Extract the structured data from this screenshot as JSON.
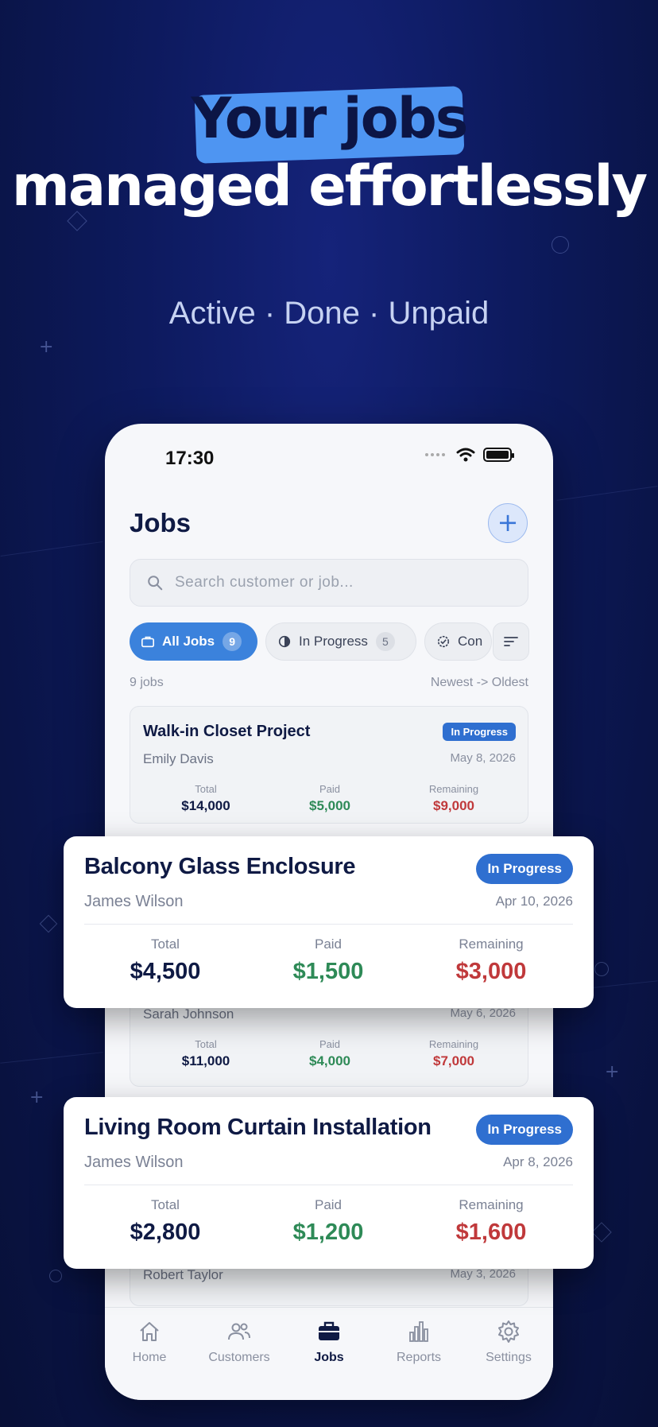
{
  "hero": {
    "highlight": "Your jobs",
    "line2": "managed effortlessly",
    "subtitle": "Active · Done · Unpaid"
  },
  "status_bar": {
    "time": "17:30"
  },
  "header": {
    "title": "Jobs",
    "add_label": "+"
  },
  "search": {
    "placeholder": "Search customer or job..."
  },
  "filters": {
    "chips": [
      {
        "label": "All Jobs",
        "count": "9"
      },
      {
        "label": "In Progress",
        "count": "5"
      },
      {
        "label": "Con"
      }
    ]
  },
  "list_meta": {
    "count": "9 jobs",
    "sort": "Newest -> Oldest"
  },
  "jobs": [
    {
      "title": "Walk-in Closet Project",
      "customer": "Emily Davis",
      "date": "May 8, 2026",
      "status": "In Progress",
      "total_label": "Total",
      "total": "$14,000",
      "paid_label": "Paid",
      "paid": "$5,000",
      "remaining_label": "Remaining",
      "remaining": "$9,000"
    },
    {
      "title": "Balcony Glass Enclosure",
      "customer": "James Wilson",
      "date": "Apr 10, 2026",
      "status": "In Progress",
      "total_label": "Total",
      "total": "$4,500",
      "paid_label": "Paid",
      "paid": "$1,500",
      "remaining_label": "Remaining",
      "remaining": "$3,000"
    },
    {
      "customer": "Sarah Johnson",
      "date": "May 6, 2026",
      "total_label": "Total",
      "total": "$11,000",
      "paid_label": "Paid",
      "paid": "$4,000",
      "remaining_label": "Remaining",
      "remaining": "$7,000"
    },
    {
      "title": "Living Room Curtain Installation",
      "customer": "James Wilson",
      "date": "Apr 8, 2026",
      "status": "In Progress",
      "total_label": "Total",
      "total": "$2,800",
      "paid_label": "Paid",
      "paid": "$1,200",
      "remaining_label": "Remaining",
      "remaining": "$1,600"
    },
    {
      "customer": "Robert Taylor",
      "date": "May 3, 2026"
    }
  ],
  "tabs": [
    {
      "label": "Home",
      "icon": "home-icon"
    },
    {
      "label": "Customers",
      "icon": "users-icon"
    },
    {
      "label": "Jobs",
      "icon": "briefcase-icon",
      "active": true
    },
    {
      "label": "Reports",
      "icon": "bar-chart-icon"
    },
    {
      "label": "Settings",
      "icon": "gear-icon"
    }
  ],
  "colors": {
    "accent": "#3b82dc",
    "badge": "#2f6fd0",
    "paid": "#2e8a57",
    "remaining": "#c0393b",
    "navy": "#0f1a44",
    "hero_highlight": "#4e95f2"
  }
}
